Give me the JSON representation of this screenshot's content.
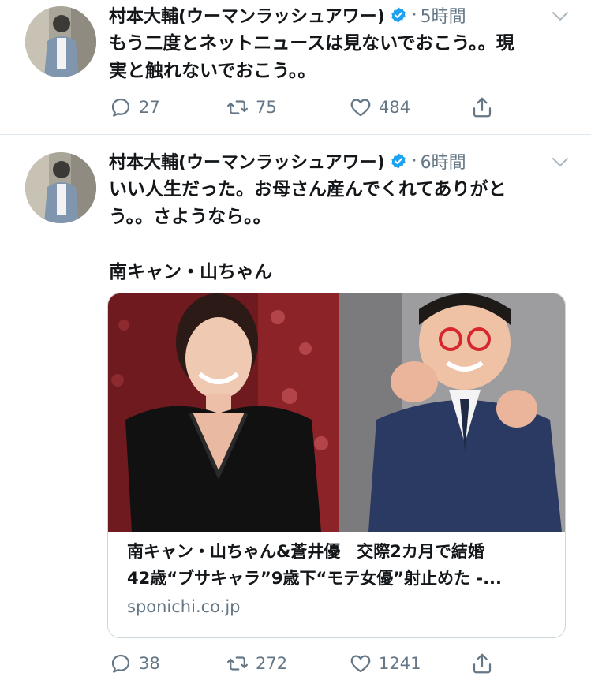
{
  "tweets": [
    {
      "author": "村本大輔(ウーマンラッシュアワー)",
      "time": "5時間",
      "text_lines": [
        "もう二度とネットニュースは見ないでおこう。。現",
        "実と触れないでおこう。。"
      ],
      "replies": "27",
      "retweets": "75",
      "likes": "484"
    },
    {
      "author": "村本大輔(ウーマンラッシュアワー)",
      "time": "6時間",
      "text_lines": [
        "いい人生だった。お母さん産んでくれてありがと",
        "う。。さようなら。。",
        "",
        "南キャン・山ちゃん"
      ],
      "card": {
        "title_line1": "南キャン・山ちゃん&蒼井優　交際2カ月で結婚",
        "title_line2": "42歳“ブサキャラ”9歳下“モテ女優”射止めた -...",
        "domain": "sponichi.co.jp"
      },
      "replies": "38",
      "retweets": "272",
      "likes": "1241"
    }
  ],
  "icons": {
    "verified": "verified-badge-icon",
    "caret": "chevron-down-icon",
    "reply": "reply-icon",
    "retweet": "retweet-icon",
    "like": "heart-icon",
    "share": "share-icon"
  },
  "colors": {
    "verified_blue": "#1da1f2",
    "muted_text": "#657786",
    "divider": "#e1e8ed"
  }
}
